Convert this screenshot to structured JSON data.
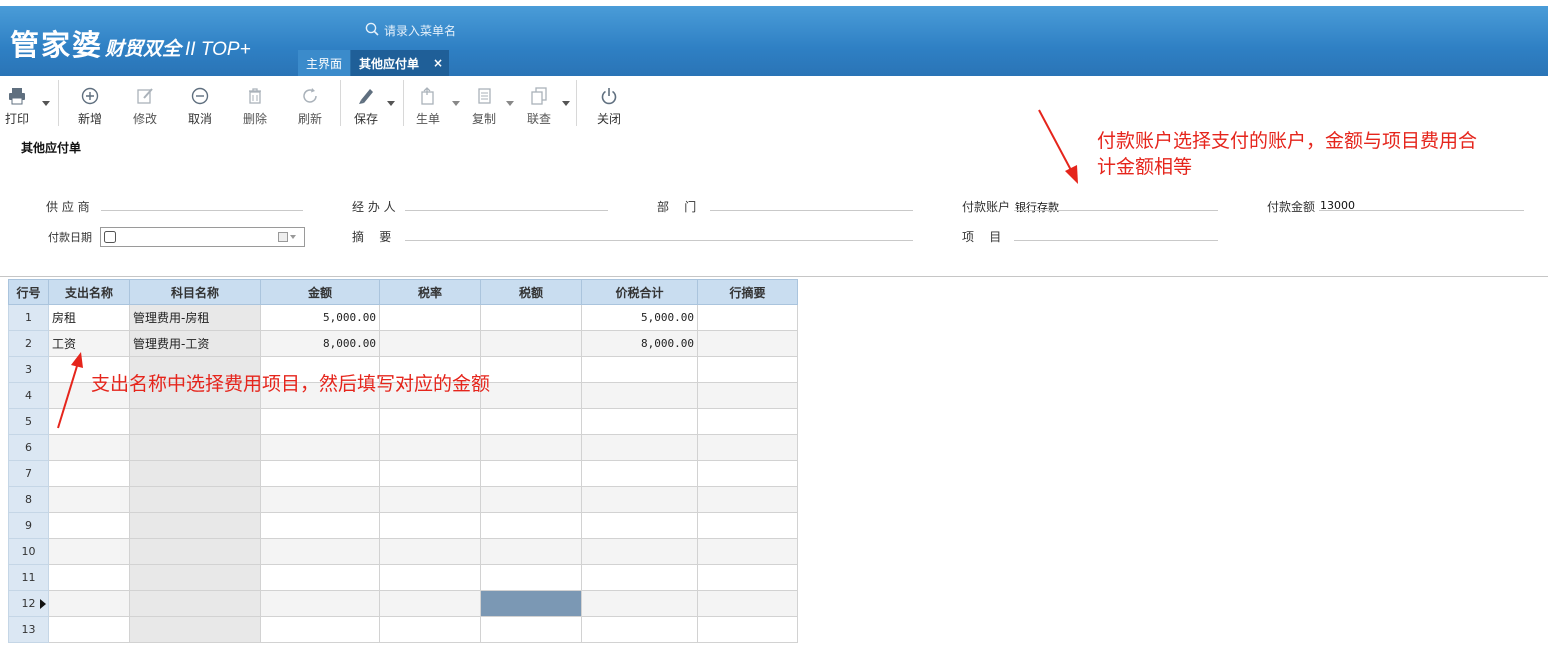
{
  "header": {
    "brand": "管家婆",
    "brand_sub": "财贸双全",
    "brand_ver": "II TOP+",
    "search_placeholder": "请录入菜单名",
    "tabs": [
      {
        "label": "主界面"
      },
      {
        "label": "其他应付单",
        "active": true
      }
    ],
    "close_glyph": "×"
  },
  "toolbar": {
    "items": [
      {
        "label": "打印",
        "icon": "printer-icon",
        "dropdown": true
      },
      {
        "label": "新增",
        "icon": "plus-circle-icon"
      },
      {
        "label": "修改",
        "icon": "edit-icon",
        "disabled": true
      },
      {
        "label": "取消",
        "icon": "minus-circle-icon"
      },
      {
        "label": "删除",
        "icon": "trash-icon",
        "disabled": true
      },
      {
        "label": "刷新",
        "icon": "refresh-icon",
        "disabled": true
      },
      {
        "label": "保存",
        "icon": "save-pen-icon",
        "dropdown": true
      },
      {
        "label": "生单",
        "icon": "generate-doc-icon",
        "dropdown": true,
        "disabled": true
      },
      {
        "label": "复制",
        "icon": "copy-doc-icon",
        "dropdown": true,
        "disabled": true
      },
      {
        "label": "联查",
        "icon": "linked-query-icon",
        "dropdown": true,
        "disabled": true
      },
      {
        "label": "关闭",
        "icon": "power-icon"
      }
    ]
  },
  "form": {
    "title": "其他应付单",
    "supplier_label": "供 应 商",
    "handler_label": "经 办 人",
    "dept_label": "部    门",
    "account_label": "付款账户",
    "account_value": "银行存款",
    "amount_label": "付款金额",
    "amount_value": "13000",
    "date_label": "付款日期",
    "summary_label": "摘    要",
    "project_label": "项    目"
  },
  "annotations": {
    "top_right": "付款账户选择支付的账户，金额与项目费用合计金额相等",
    "top_right_line1": "付款账户选择支付的账户，金额与项目费用合",
    "top_right_line2": "计金额相等",
    "grid_note": "支出名称中选择费用项目，然后填写对应的金额",
    "color": "#e5251c"
  },
  "grid": {
    "columns": [
      "行号",
      "支出名称",
      "科目名称",
      "金额",
      "税率",
      "税额",
      "价税合计",
      "行摘要"
    ],
    "rows": [
      [
        "1",
        "房租",
        "管理费用-房租",
        "5,000.00",
        "",
        "",
        "5,000.00",
        ""
      ],
      [
        "2",
        "工资",
        "管理费用-工资",
        "8,000.00",
        "",
        "",
        "8,000.00",
        ""
      ],
      [
        "3",
        "",
        "",
        "",
        "",
        "",
        "",
        ""
      ],
      [
        "4",
        "",
        "",
        "",
        "",
        "",
        "",
        ""
      ],
      [
        "5",
        "",
        "",
        "",
        "",
        "",
        "",
        ""
      ],
      [
        "6",
        "",
        "",
        "",
        "",
        "",
        "",
        ""
      ],
      [
        "7",
        "",
        "",
        "",
        "",
        "",
        "",
        ""
      ],
      [
        "8",
        "",
        "",
        "",
        "",
        "",
        "",
        ""
      ],
      [
        "9",
        "",
        "",
        "",
        "",
        "",
        "",
        ""
      ],
      [
        "10",
        "",
        "",
        "",
        "",
        "",
        "",
        ""
      ],
      [
        "11",
        "",
        "",
        "",
        "",
        "",
        "",
        ""
      ],
      [
        "12",
        "",
        "",
        "",
        "",
        "",
        "",
        ""
      ],
      [
        "13",
        "",
        "",
        "",
        "",
        "",
        "",
        ""
      ]
    ],
    "current_row": "12",
    "selected_cell_color": "#7b98b4"
  }
}
